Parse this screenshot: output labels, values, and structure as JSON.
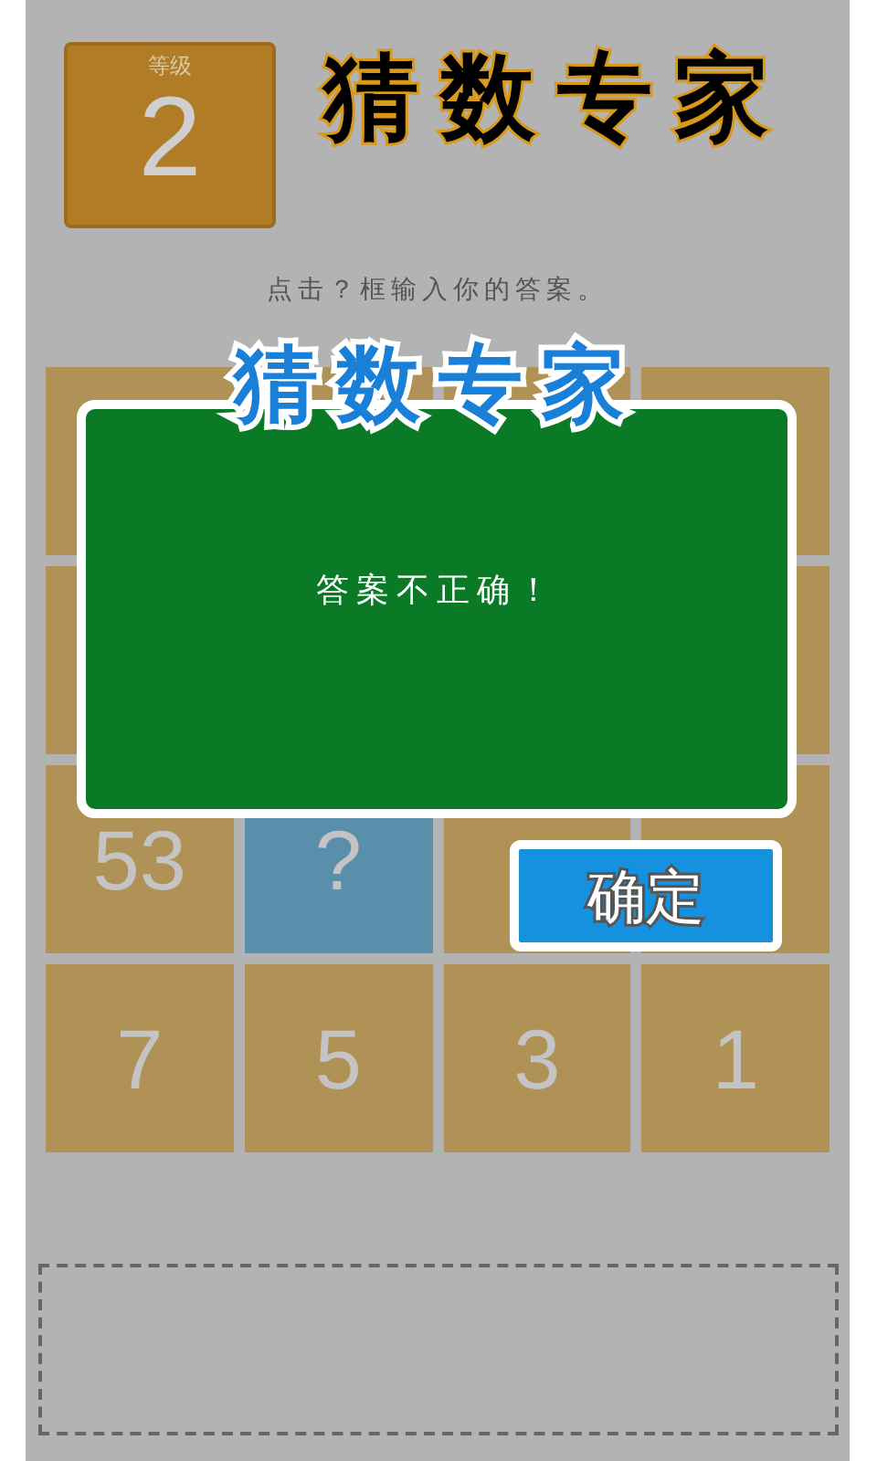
{
  "level": {
    "label": "等级",
    "value": "2"
  },
  "title": "猜数专家",
  "instruction": "点击？框输入你的答案。",
  "grid": [
    {
      "kind": "tile"
    },
    {
      "kind": "tile"
    },
    {
      "kind": "tile"
    },
    {
      "kind": "tile"
    },
    {
      "kind": "tile"
    },
    {
      "kind": "hidden"
    },
    {
      "kind": "hidden"
    },
    {
      "kind": "tile"
    },
    {
      "kind": "tile",
      "value": "53"
    },
    {
      "kind": "question",
      "value": "?"
    },
    {
      "kind": "tile"
    },
    {
      "kind": "tile"
    },
    {
      "kind": "tile",
      "value": "7"
    },
    {
      "kind": "tile",
      "value": "5"
    },
    {
      "kind": "tile",
      "value": "3"
    },
    {
      "kind": "tile",
      "value": "1"
    }
  ],
  "dialog": {
    "title": "猜数专家",
    "message": "答案不正确！",
    "button": "确定"
  }
}
